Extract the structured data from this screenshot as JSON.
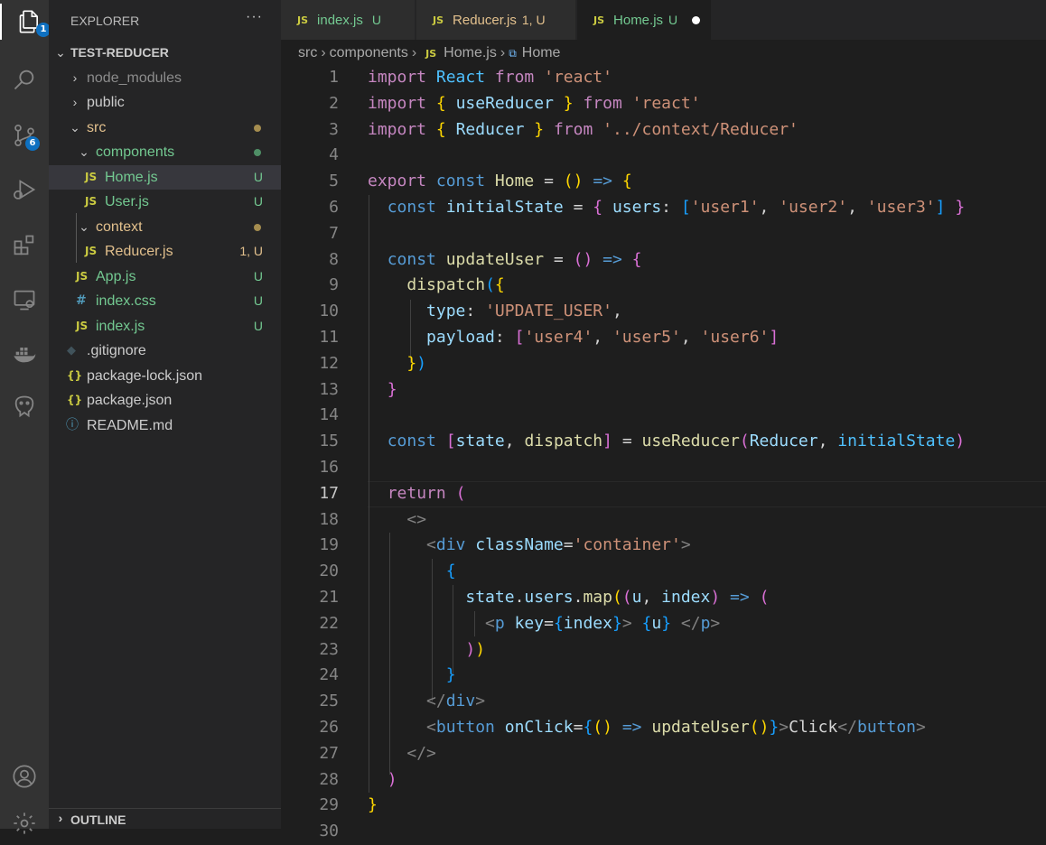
{
  "activity_bar": {
    "explorer_badge": "1",
    "scm_badge": "6"
  },
  "explorer": {
    "title": "EXPLORER",
    "more": "···",
    "project": "TEST-REDUCER",
    "items": [
      {
        "name": "node_modules",
        "status": ""
      },
      {
        "name": "public",
        "status": ""
      },
      {
        "name": "src",
        "status": ""
      },
      {
        "name": "components",
        "status": ""
      },
      {
        "name": "Home.js",
        "status": "U",
        "icon": "JS"
      },
      {
        "name": "User.js",
        "status": "U",
        "icon": "JS"
      },
      {
        "name": "context",
        "status": ""
      },
      {
        "name": "Reducer.js",
        "status": "1, U",
        "icon": "JS"
      },
      {
        "name": "App.js",
        "status": "U",
        "icon": "JS"
      },
      {
        "name": "index.css",
        "status": "U",
        "icon": "#"
      },
      {
        "name": "index.js",
        "status": "U",
        "icon": "JS"
      },
      {
        "name": ".gitignore",
        "status": ""
      },
      {
        "name": "package-lock.json",
        "status": "",
        "icon": "{}"
      },
      {
        "name": "package.json",
        "status": "",
        "icon": "{}"
      },
      {
        "name": "README.md",
        "status": "",
        "icon": "ⓘ"
      }
    ],
    "outline": "OUTLINE"
  },
  "tabs": [
    {
      "icon": "JS",
      "label": "index.js",
      "status": "U"
    },
    {
      "icon": "JS",
      "label": "Reducer.js",
      "status": "1, U"
    },
    {
      "icon": "JS",
      "label": "Home.js",
      "status": "U"
    }
  ],
  "breadcrumb": {
    "parts": [
      "src",
      "components",
      "Home.js",
      "Home"
    ],
    "file_icon": "JS"
  },
  "editor": {
    "current_line": 17,
    "line_numbers": [
      "1",
      "2",
      "3",
      "4",
      "5",
      "6",
      "7",
      "8",
      "9",
      "10",
      "11",
      "12",
      "13",
      "14",
      "15",
      "16",
      "17",
      "18",
      "19",
      "20",
      "21",
      "22",
      "23",
      "24",
      "25",
      "26",
      "27",
      "28",
      "29",
      "30"
    ],
    "lines": [
      [
        [
          "kw",
          "import"
        ],
        [
          "pl",
          " "
        ],
        [
          "cn",
          "React"
        ],
        [
          "pl",
          " "
        ],
        [
          "kw",
          "from"
        ],
        [
          "pl",
          " "
        ],
        [
          "str",
          "'react'"
        ]
      ],
      [
        [
          "kw",
          "import"
        ],
        [
          "pl",
          " "
        ],
        [
          "b1",
          "{"
        ],
        [
          "pl",
          " "
        ],
        [
          "vr",
          "useReducer"
        ],
        [
          "pl",
          " "
        ],
        [
          "b1",
          "}"
        ],
        [
          "pl",
          " "
        ],
        [
          "kw",
          "from"
        ],
        [
          "pl",
          " "
        ],
        [
          "str",
          "'react'"
        ]
      ],
      [
        [
          "kw",
          "import"
        ],
        [
          "pl",
          " "
        ],
        [
          "b1",
          "{"
        ],
        [
          "pl",
          " "
        ],
        [
          "vr",
          "Reducer"
        ],
        [
          "pl",
          " "
        ],
        [
          "b1",
          "}"
        ],
        [
          "pl",
          " "
        ],
        [
          "kw",
          "from"
        ],
        [
          "pl",
          " "
        ],
        [
          "str",
          "'../context/Reducer'"
        ]
      ],
      [],
      [
        [
          "kw",
          "export"
        ],
        [
          "pl",
          " "
        ],
        [
          "st",
          "const"
        ],
        [
          "pl",
          " "
        ],
        [
          "fn",
          "Home"
        ],
        [
          "pl",
          " = "
        ],
        [
          "b1",
          "()"
        ],
        [
          "pl",
          " "
        ],
        [
          "st",
          "=>"
        ],
        [
          "pl",
          " "
        ],
        [
          "b1",
          "{"
        ]
      ],
      [
        [
          "pl",
          "  "
        ],
        [
          "st",
          "const"
        ],
        [
          "pl",
          " "
        ],
        [
          "vr",
          "initialState"
        ],
        [
          "pl",
          " = "
        ],
        [
          "b2",
          "{"
        ],
        [
          "pl",
          " "
        ],
        [
          "vr",
          "users"
        ],
        [
          "pl",
          ": "
        ],
        [
          "b3",
          "["
        ],
        [
          "str",
          "'user1'"
        ],
        [
          "pl",
          ", "
        ],
        [
          "str",
          "'user2'"
        ],
        [
          "pl",
          ", "
        ],
        [
          "str",
          "'user3'"
        ],
        [
          "b3",
          "]"
        ],
        [
          "pl",
          " "
        ],
        [
          "b2",
          "}"
        ]
      ],
      [],
      [
        [
          "pl",
          "  "
        ],
        [
          "st",
          "const"
        ],
        [
          "pl",
          " "
        ],
        [
          "fn",
          "updateUser"
        ],
        [
          "pl",
          " = "
        ],
        [
          "b2",
          "()"
        ],
        [
          "pl",
          " "
        ],
        [
          "st",
          "=>"
        ],
        [
          "pl",
          " "
        ],
        [
          "b2",
          "{"
        ]
      ],
      [
        [
          "pl",
          "    "
        ],
        [
          "fn",
          "dispatch"
        ],
        [
          "b3",
          "("
        ],
        [
          "b1",
          "{"
        ]
      ],
      [
        [
          "pl",
          "      "
        ],
        [
          "vr",
          "type"
        ],
        [
          "pl",
          ": "
        ],
        [
          "str",
          "'UPDATE_USER'"
        ],
        [
          "pl",
          ","
        ]
      ],
      [
        [
          "pl",
          "      "
        ],
        [
          "vr",
          "payload"
        ],
        [
          "pl",
          ": "
        ],
        [
          "b2",
          "["
        ],
        [
          "str",
          "'user4'"
        ],
        [
          "pl",
          ", "
        ],
        [
          "str",
          "'user5'"
        ],
        [
          "pl",
          ", "
        ],
        [
          "str",
          "'user6'"
        ],
        [
          "b2",
          "]"
        ]
      ],
      [
        [
          "pl",
          "    "
        ],
        [
          "b1",
          "}"
        ],
        [
          "b3",
          ")"
        ]
      ],
      [
        [
          "pl",
          "  "
        ],
        [
          "b2",
          "}"
        ]
      ],
      [],
      [
        [
          "pl",
          "  "
        ],
        [
          "st",
          "const"
        ],
        [
          "pl",
          " "
        ],
        [
          "b2",
          "["
        ],
        [
          "vr",
          "state"
        ],
        [
          "pl",
          ", "
        ],
        [
          "fn",
          "dispatch"
        ],
        [
          "b2",
          "]"
        ],
        [
          "pl",
          " = "
        ],
        [
          "fn",
          "useReducer"
        ],
        [
          "b2",
          "("
        ],
        [
          "vr",
          "Reducer"
        ],
        [
          "pl",
          ", "
        ],
        [
          "cn",
          "initialState"
        ],
        [
          "b2",
          ")"
        ]
      ],
      [],
      [
        [
          "pl",
          "  "
        ],
        [
          "kw",
          "return"
        ],
        [
          "pl",
          " "
        ],
        [
          "b2",
          "("
        ]
      ],
      [
        [
          "pl",
          "    "
        ],
        [
          "tgb",
          "<>"
        ]
      ],
      [
        [
          "pl",
          "      "
        ],
        [
          "tgb",
          "<"
        ],
        [
          "tg",
          "div"
        ],
        [
          "pl",
          " "
        ],
        [
          "at",
          "className"
        ],
        [
          "pl",
          "="
        ],
        [
          "str",
          "'container'"
        ],
        [
          "tgb",
          ">"
        ]
      ],
      [
        [
          "pl",
          "        "
        ],
        [
          "b3",
          "{"
        ]
      ],
      [
        [
          "pl",
          "          "
        ],
        [
          "vr",
          "state"
        ],
        [
          "pl",
          "."
        ],
        [
          "vr",
          "users"
        ],
        [
          "pl",
          "."
        ],
        [
          "fn",
          "map"
        ],
        [
          "b1",
          "("
        ],
        [
          "b2",
          "("
        ],
        [
          "vr",
          "u"
        ],
        [
          "pl",
          ", "
        ],
        [
          "vr",
          "index"
        ],
        [
          "b2",
          ")"
        ],
        [
          "pl",
          " "
        ],
        [
          "st",
          "=>"
        ],
        [
          "pl",
          " "
        ],
        [
          "b2",
          "("
        ]
      ],
      [
        [
          "pl",
          "            "
        ],
        [
          "tgb",
          "<"
        ],
        [
          "tg",
          "p"
        ],
        [
          "pl",
          " "
        ],
        [
          "at",
          "key"
        ],
        [
          "pl",
          "="
        ],
        [
          "b3",
          "{"
        ],
        [
          "vr",
          "index"
        ],
        [
          "b3",
          "}"
        ],
        [
          "tgb",
          ">"
        ],
        [
          "pl",
          " "
        ],
        [
          "b3",
          "{"
        ],
        [
          "vr",
          "u"
        ],
        [
          "b3",
          "}"
        ],
        [
          "pl",
          " "
        ],
        [
          "tgb",
          "</"
        ],
        [
          "tg",
          "p"
        ],
        [
          "tgb",
          ">"
        ]
      ],
      [
        [
          "pl",
          "          "
        ],
        [
          "b2",
          ")"
        ],
        [
          "b1",
          ")"
        ]
      ],
      [
        [
          "pl",
          "        "
        ],
        [
          "b3",
          "}"
        ]
      ],
      [
        [
          "pl",
          "      "
        ],
        [
          "tgb",
          "</"
        ],
        [
          "tg",
          "div"
        ],
        [
          "tgb",
          ">"
        ]
      ],
      [
        [
          "pl",
          "      "
        ],
        [
          "tgb",
          "<"
        ],
        [
          "tg",
          "button"
        ],
        [
          "pl",
          " "
        ],
        [
          "at",
          "onClick"
        ],
        [
          "pl",
          "="
        ],
        [
          "b3",
          "{"
        ],
        [
          "b1",
          "()"
        ],
        [
          "pl",
          " "
        ],
        [
          "st",
          "=>"
        ],
        [
          "pl",
          " "
        ],
        [
          "fn",
          "updateUser"
        ],
        [
          "b1",
          "()"
        ],
        [
          "b3",
          "}"
        ],
        [
          "tgb",
          ">"
        ],
        [
          "pl",
          "Click"
        ],
        [
          "tgb",
          "</"
        ],
        [
          "tg",
          "button"
        ],
        [
          "tgb",
          ">"
        ]
      ],
      [
        [
          "pl",
          "    "
        ],
        [
          "tgb",
          "</>"
        ]
      ],
      [
        [
          "pl",
          "  "
        ],
        [
          "b2",
          ")"
        ]
      ],
      [
        [
          "b1",
          "}"
        ]
      ],
      []
    ]
  },
  "colors": {
    "activity_bar": "#333333",
    "sidebar": "#252526",
    "editor_bg": "#1e1e1e",
    "untracked": "#73c991",
    "modified": "#e2c08d",
    "badge": "#0e70c0"
  }
}
